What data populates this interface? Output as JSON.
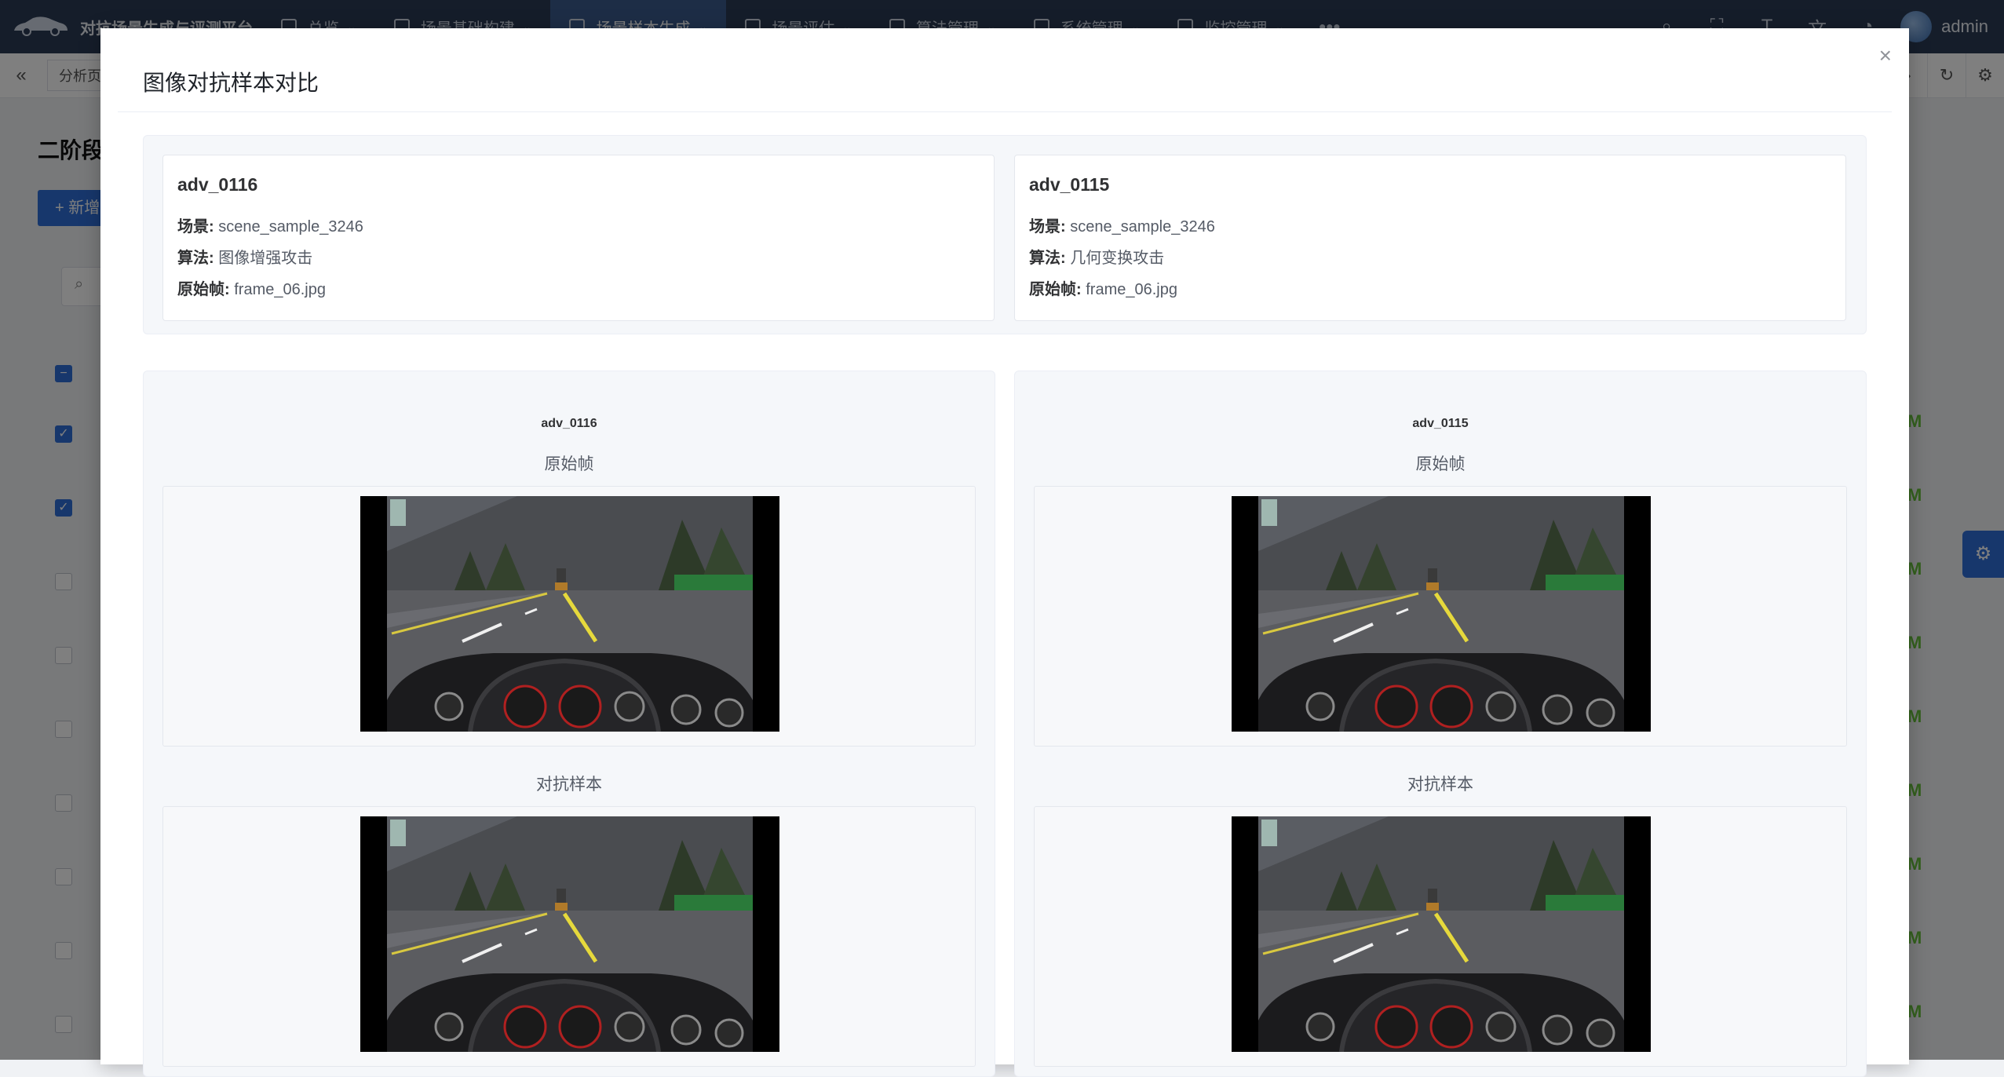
{
  "app": {
    "title": "对抗场景生成与评测平台",
    "nav": [
      {
        "label": "总览",
        "active": false
      },
      {
        "label": "场景基础构建",
        "active": false
      },
      {
        "label": "场景样本生成",
        "active": true
      },
      {
        "label": "场景评估",
        "active": false
      },
      {
        "label": "算法管理",
        "active": false
      },
      {
        "label": "系统管理",
        "active": false
      },
      {
        "label": "监控管理",
        "active": false
      }
    ],
    "more": "•••",
    "user": "admin",
    "tabs": [
      "分析页"
    ],
    "page_title": "二阶段",
    "new_button": "+ 新增",
    "row_tag": "M",
    "accent": "#2f6fd8"
  },
  "modal": {
    "title": "图像对抗样本对比",
    "close": "×",
    "samples": [
      {
        "name": "adv_0116",
        "scene_label": "场景:",
        "scene": "scene_sample_3246",
        "algo_label": "算法:",
        "algo": "图像增强攻击",
        "frame_label": "原始帧:",
        "frame": "frame_06.jpg"
      },
      {
        "name": "adv_0115",
        "scene_label": "场景:",
        "scene": "scene_sample_3246",
        "algo_label": "算法:",
        "algo": "几何变换攻击",
        "frame_label": "原始帧:",
        "frame": "frame_06.jpg"
      }
    ],
    "original_label": "原始帧",
    "adversarial_label": "对抗样本"
  }
}
